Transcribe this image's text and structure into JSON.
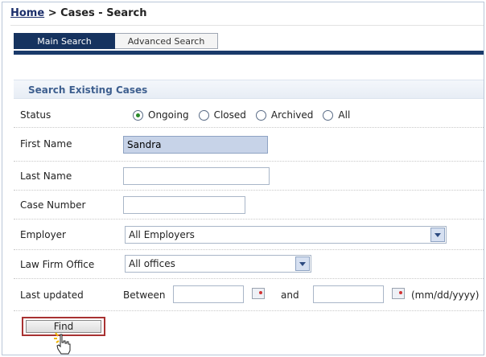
{
  "breadcrumb": {
    "home": "Home",
    "separator": " > ",
    "current": "Cases - Search"
  },
  "tabs": [
    {
      "label": "Main Search",
      "active": true
    },
    {
      "label": "Advanced Search",
      "active": false
    }
  ],
  "section_title": "Search Existing Cases",
  "form": {
    "status": {
      "label": "Status",
      "options": [
        "Ongoing",
        "Closed",
        "Archived",
        "All"
      ],
      "selected": "Ongoing"
    },
    "first_name": {
      "label": "First Name",
      "value": "Sandra"
    },
    "last_name": {
      "label": "Last Name",
      "value": ""
    },
    "case_number": {
      "label": "Case Number",
      "value": ""
    },
    "employer": {
      "label": "Employer",
      "value": "All Employers"
    },
    "law_firm_office": {
      "label": "Law Firm Office",
      "value": "All offices"
    },
    "last_updated": {
      "label": "Last updated",
      "between": "Between",
      "and": "and",
      "format_hint": "(mm/dd/yyyy)",
      "from": "",
      "to": ""
    }
  },
  "find_button": "Find",
  "colors": {
    "tab_active": "#16335f",
    "section_title": "#3e5f8f",
    "highlight_field": "#c7d3e8",
    "find_border": "#a83232"
  }
}
